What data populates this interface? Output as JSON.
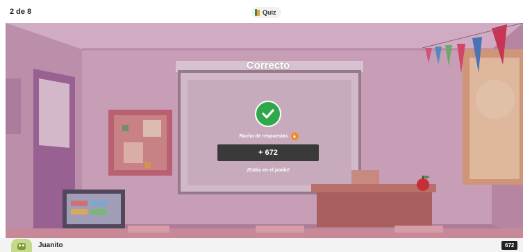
{
  "header": {
    "progress": "2 de 8",
    "quiz_label": "Quiz"
  },
  "result": {
    "title": "Correcto",
    "streak_label": "Racha de respuestas",
    "points": "+ 672",
    "podium_message": "¡Estás en el podio!"
  },
  "footer": {
    "player_name": "Juanito",
    "score": "672"
  },
  "colors": {
    "correct_green": "#2ea84a",
    "points_bg": "#3a3a3a",
    "streak_orange": "#f08a24",
    "scene_tint": "#c8a1b5"
  },
  "icons": {
    "quiz": "book-icon",
    "result": "check-icon",
    "streak": "flame-icon",
    "avatar": "robot-avatar"
  }
}
